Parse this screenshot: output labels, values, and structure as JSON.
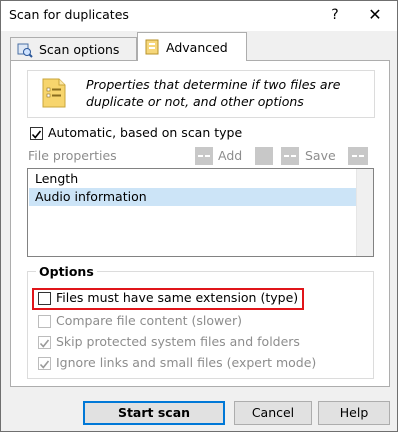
{
  "window": {
    "title": "Scan for duplicates",
    "help_glyph": "?",
    "close_glyph": "✕"
  },
  "tabs": [
    {
      "label": "Scan options",
      "icon": "scan-options-icon",
      "active": false
    },
    {
      "label": "Advanced",
      "icon": "advanced-icon",
      "active": true
    }
  ],
  "info": {
    "text_line1": "Properties that determine if two files are",
    "text_line2": "duplicate or not, and other options",
    "icon": "document-properties-icon"
  },
  "automatic": {
    "label": "Automatic, based on scan type",
    "checked": true
  },
  "file_properties": {
    "placeholder": "File properties",
    "add_label": "Add",
    "save_label": "Save",
    "items": [
      {
        "label": "Length",
        "selected": false
      },
      {
        "label": "Audio information",
        "selected": true
      }
    ]
  },
  "options": {
    "title": "Options",
    "items": [
      {
        "label": "Files must have same extension (type)",
        "checked": false,
        "enabled": true,
        "highlighted": true
      },
      {
        "label": "Compare file content (slower)",
        "checked": false,
        "enabled": false
      },
      {
        "label": "Skip protected system files and folders",
        "checked": true,
        "enabled": false
      },
      {
        "label": "Ignore links and small files (expert mode)",
        "checked": true,
        "enabled": false
      }
    ]
  },
  "buttons": {
    "start_scan": "Start scan",
    "cancel": "Cancel",
    "help": "Help"
  },
  "colors": {
    "highlight_border": "#e0151a",
    "selection": "#cce4f7",
    "primary_border": "#0078d7"
  }
}
